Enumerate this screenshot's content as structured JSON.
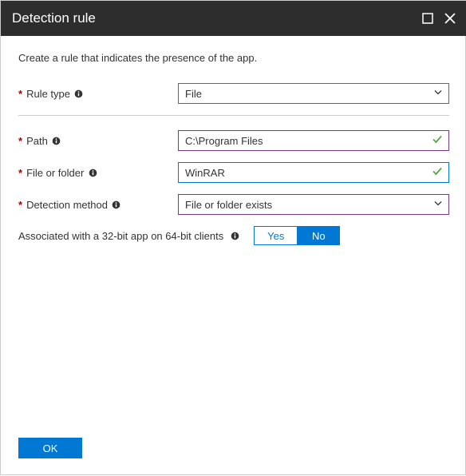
{
  "header": {
    "title": "Detection rule"
  },
  "description": "Create a rule that indicates the presence of the app.",
  "fields": {
    "ruleType": {
      "label": "Rule type",
      "value": "File"
    },
    "path": {
      "label": "Path",
      "value": "C:\\Program Files"
    },
    "fileOrFolder": {
      "label": "File or folder",
      "value": "WinRAR"
    },
    "detectionMethod": {
      "label": "Detection method",
      "value": "File or folder exists"
    }
  },
  "toggle": {
    "label": "Associated with a 32-bit app on 64-bit clients",
    "yes": "Yes",
    "no": "No",
    "selected": "No"
  },
  "footer": {
    "ok": "OK"
  }
}
